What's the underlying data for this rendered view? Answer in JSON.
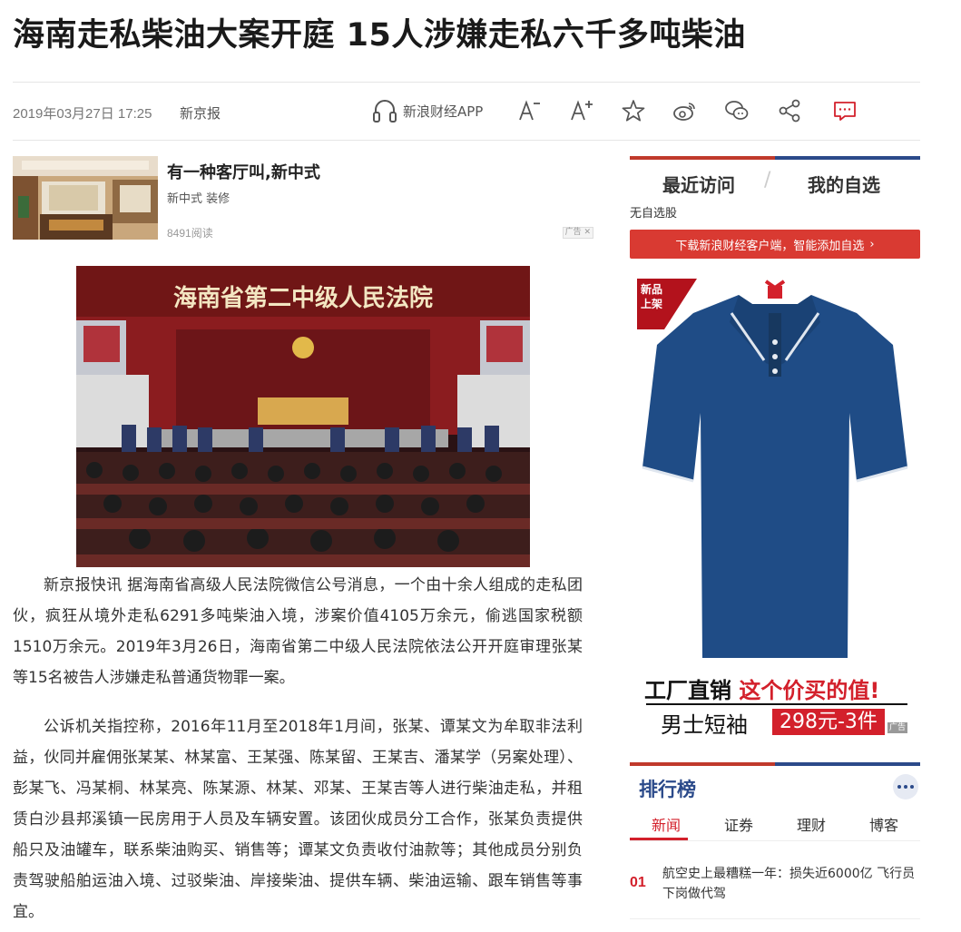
{
  "article": {
    "title": "海南走私柴油大案开庭 15人涉嫌走私六千多吨柴油",
    "date": "2019年03月27日 17:25",
    "source": "新京报",
    "paragraphs": [
      "新京报快讯 据海南省高级人民法院微信公号消息，一个由十余人组成的走私团伙，疯狂从境外走私6291多吨柴油入境，涉案价值4105万余元，偷逃国家税额1510万余元。2019年3月26日，海南省第二中级人民法院依法公开开庭审理张某等15名被告人涉嫌走私普通货物罪一案。",
      "公诉机关指控称，2016年11月至2018年1月间，张某、谭某文为牟取非法利益，伙同并雇佣张某某、林某富、王某强、陈某留、王某吉、潘某学（另案处理）、彭某飞、冯某桐、林某亮、陈某源、林某、邓某、王某吉等人进行柴油走私，并租赁白沙县邦溪镇一民房用于人员及车辆安置。该团伙成员分工合作，张某负责提供船只及油罐车，联系柴油购买、销售等；谭某文负责收付油款等；其他成员分别负责驾驶船舶运油入境、过驳柴油、岸接柴油、提供车辆、柴油运输、跟车销售等事宜。"
    ],
    "photo_banner": "海南省第二中级人民法院"
  },
  "toolbar": {
    "app_label": "新浪财经APP"
  },
  "ad": {
    "title": "有一种客厅叫,新中式",
    "tags": "新中式 装修",
    "reads": "8491阅读",
    "badge": "广告"
  },
  "sidebar": {
    "tab_recent": "最近访问",
    "tab_slash": "/",
    "tab_mine": "我的自选",
    "no_stock": "无自选股",
    "download_label": "下载新浪财经客户端，智能添加自选",
    "shirt_ad": {
      "new_tag_line1": "新品",
      "new_tag_line2": "上架",
      "slogan1_black": "工厂直销",
      "slogan1_red": "这个价买的值",
      "slogan1_mark": "!",
      "slogan2": "男士短袖",
      "price": "298元-3件",
      "badge": "广告"
    },
    "ranking": {
      "title": "排行榜",
      "tabs": [
        "新闻",
        "证券",
        "理财",
        "博客"
      ],
      "items": [
        {
          "num": "01",
          "text": "航空史上最糟糕一年：损失近6000亿 飞行员下岗做代驾"
        }
      ]
    }
  },
  "colors": {
    "accent_red": "#d3202b",
    "accent_blue": "#2b4a8a",
    "shirt_blue": "#1f4c86"
  }
}
